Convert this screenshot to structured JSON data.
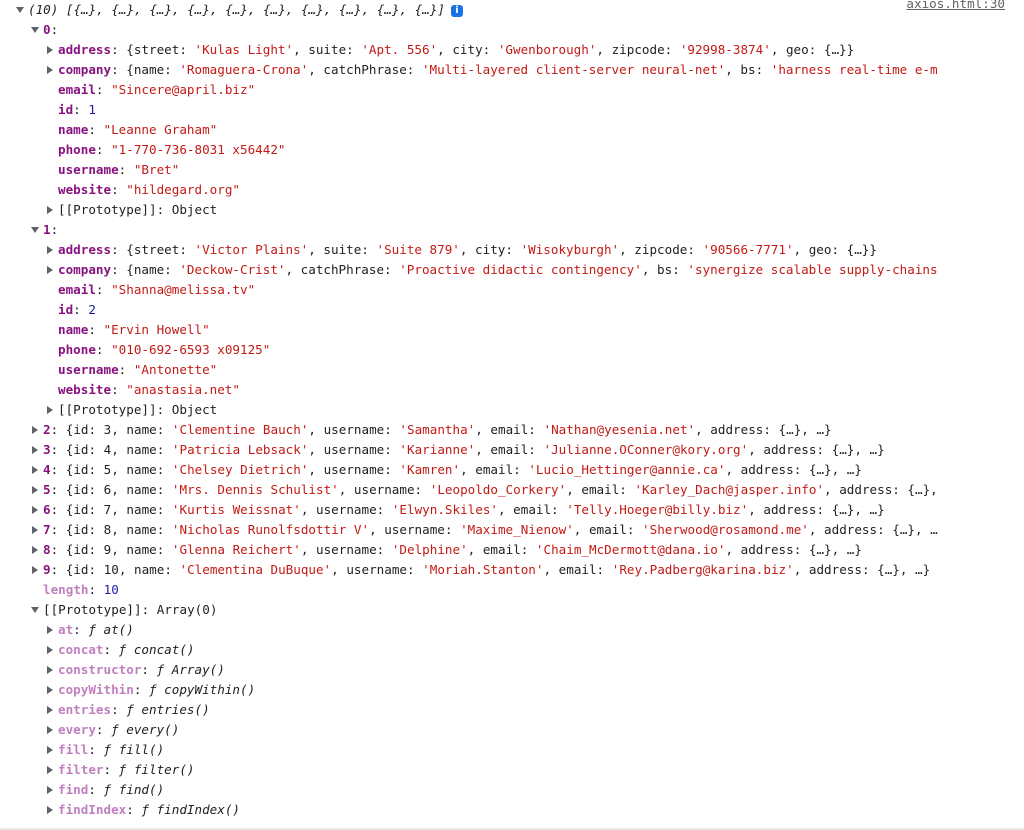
{
  "source_link": "axios.html:30",
  "summary": {
    "label": "(10) [{…}, {…}, {…}, {…}, {…}, {…}, {…}, {…}, {…}, {…}]",
    "info_icon": "info-icon"
  },
  "items": [
    {
      "index": "0",
      "expanded": true,
      "fields": [
        {
          "key": "address",
          "expandable": true,
          "segments": [
            [
              "p",
              "{street: "
            ],
            [
              "s",
              "'Kulas Light'"
            ],
            [
              "p",
              ", suite: "
            ],
            [
              "s",
              "'Apt. 556'"
            ],
            [
              "p",
              ", city: "
            ],
            [
              "s",
              "'Gwenborough'"
            ],
            [
              "p",
              ", zipcode: "
            ],
            [
              "s",
              "'92998-3874'"
            ],
            [
              "p",
              ", geo: {…}}"
            ]
          ]
        },
        {
          "key": "company",
          "expandable": true,
          "segments": [
            [
              "p",
              "{name: "
            ],
            [
              "s",
              "'Romaguera-Crona'"
            ],
            [
              "p",
              ", catchPhrase: "
            ],
            [
              "s",
              "'Multi-layered client-server neural-net'"
            ],
            [
              "p",
              ", bs: "
            ],
            [
              "s",
              "'harness real-time e-m"
            ]
          ]
        },
        {
          "key": "email",
          "expandable": false,
          "segments": [
            [
              "s",
              "\"Sincere@april.biz\""
            ]
          ]
        },
        {
          "key": "id",
          "expandable": false,
          "segments": [
            [
              "n",
              "1"
            ]
          ]
        },
        {
          "key": "name",
          "expandable": false,
          "segments": [
            [
              "s",
              "\"Leanne Graham\""
            ]
          ]
        },
        {
          "key": "phone",
          "expandable": false,
          "segments": [
            [
              "s",
              "\"1-770-736-8031 x56442\""
            ]
          ]
        },
        {
          "key": "username",
          "expandable": false,
          "segments": [
            [
              "s",
              "\"Bret\""
            ]
          ]
        },
        {
          "key": "website",
          "expandable": false,
          "segments": [
            [
              "s",
              "\"hildegard.org\""
            ]
          ]
        },
        {
          "key": "[[Prototype]]",
          "expandable": true,
          "plainkey": true,
          "segments": [
            [
              "p",
              "Object"
            ]
          ]
        }
      ]
    },
    {
      "index": "1",
      "expanded": true,
      "fields": [
        {
          "key": "address",
          "expandable": true,
          "segments": [
            [
              "p",
              "{street: "
            ],
            [
              "s",
              "'Victor Plains'"
            ],
            [
              "p",
              ", suite: "
            ],
            [
              "s",
              "'Suite 879'"
            ],
            [
              "p",
              ", city: "
            ],
            [
              "s",
              "'Wisokyburgh'"
            ],
            [
              "p",
              ", zipcode: "
            ],
            [
              "s",
              "'90566-7771'"
            ],
            [
              "p",
              ", geo: {…}}"
            ]
          ]
        },
        {
          "key": "company",
          "expandable": true,
          "segments": [
            [
              "p",
              "{name: "
            ],
            [
              "s",
              "'Deckow-Crist'"
            ],
            [
              "p",
              ", catchPhrase: "
            ],
            [
              "s",
              "'Proactive didactic contingency'"
            ],
            [
              "p",
              ", bs: "
            ],
            [
              "s",
              "'synergize scalable supply-chains"
            ]
          ]
        },
        {
          "key": "email",
          "expandable": false,
          "segments": [
            [
              "s",
              "\"Shanna@melissa.tv\""
            ]
          ]
        },
        {
          "key": "id",
          "expandable": false,
          "segments": [
            [
              "n",
              "2"
            ]
          ]
        },
        {
          "key": "name",
          "expandable": false,
          "segments": [
            [
              "s",
              "\"Ervin Howell\""
            ]
          ]
        },
        {
          "key": "phone",
          "expandable": false,
          "segments": [
            [
              "s",
              "\"010-692-6593 x09125\""
            ]
          ]
        },
        {
          "key": "username",
          "expandable": false,
          "segments": [
            [
              "s",
              "\"Antonette\""
            ]
          ]
        },
        {
          "key": "website",
          "expandable": false,
          "segments": [
            [
              "s",
              "\"anastasia.net\""
            ]
          ]
        },
        {
          "key": "[[Prototype]]",
          "expandable": true,
          "plainkey": true,
          "segments": [
            [
              "p",
              "Object"
            ]
          ]
        }
      ]
    },
    {
      "index": "2",
      "expanded": false,
      "segments": [
        [
          "p",
          "{id: 3, name: "
        ],
        [
          "s",
          "'Clementine Bauch'"
        ],
        [
          "p",
          ", username: "
        ],
        [
          "s",
          "'Samantha'"
        ],
        [
          "p",
          ", email: "
        ],
        [
          "s",
          "'Nathan@yesenia.net'"
        ],
        [
          "p",
          ", address: {…}, …}"
        ]
      ]
    },
    {
      "index": "3",
      "expanded": false,
      "segments": [
        [
          "p",
          "{id: 4, name: "
        ],
        [
          "s",
          "'Patricia Lebsack'"
        ],
        [
          "p",
          ", username: "
        ],
        [
          "s",
          "'Karianne'"
        ],
        [
          "p",
          ", email: "
        ],
        [
          "s",
          "'Julianne.OConner@kory.org'"
        ],
        [
          "p",
          ", address: {…}, …}"
        ]
      ]
    },
    {
      "index": "4",
      "expanded": false,
      "segments": [
        [
          "p",
          "{id: 5, name: "
        ],
        [
          "s",
          "'Chelsey Dietrich'"
        ],
        [
          "p",
          ", username: "
        ],
        [
          "s",
          "'Kamren'"
        ],
        [
          "p",
          ", email: "
        ],
        [
          "s",
          "'Lucio_Hettinger@annie.ca'"
        ],
        [
          "p",
          ", address: {…}, …}"
        ]
      ]
    },
    {
      "index": "5",
      "expanded": false,
      "segments": [
        [
          "p",
          "{id: 6, name: "
        ],
        [
          "s",
          "'Mrs. Dennis Schulist'"
        ],
        [
          "p",
          ", username: "
        ],
        [
          "s",
          "'Leopoldo_Corkery'"
        ],
        [
          "p",
          ", email: "
        ],
        [
          "s",
          "'Karley_Dach@jasper.info'"
        ],
        [
          "p",
          ", address: {…},"
        ]
      ]
    },
    {
      "index": "6",
      "expanded": false,
      "segments": [
        [
          "p",
          "{id: 7, name: "
        ],
        [
          "s",
          "'Kurtis Weissnat'"
        ],
        [
          "p",
          ", username: "
        ],
        [
          "s",
          "'Elwyn.Skiles'"
        ],
        [
          "p",
          ", email: "
        ],
        [
          "s",
          "'Telly.Hoeger@billy.biz'"
        ],
        [
          "p",
          ", address: {…}, …}"
        ]
      ]
    },
    {
      "index": "7",
      "expanded": false,
      "segments": [
        [
          "p",
          "{id: 8, name: "
        ],
        [
          "s",
          "'Nicholas Runolfsdottir V'"
        ],
        [
          "p",
          ", username: "
        ],
        [
          "s",
          "'Maxime_Nienow'"
        ],
        [
          "p",
          ", email: "
        ],
        [
          "s",
          "'Sherwood@rosamond.me'"
        ],
        [
          "p",
          ", address: {…}, …"
        ]
      ]
    },
    {
      "index": "8",
      "expanded": false,
      "segments": [
        [
          "p",
          "{id: 9, name: "
        ],
        [
          "s",
          "'Glenna Reichert'"
        ],
        [
          "p",
          ", username: "
        ],
        [
          "s",
          "'Delphine'"
        ],
        [
          "p",
          ", email: "
        ],
        [
          "s",
          "'Chaim_McDermott@dana.io'"
        ],
        [
          "p",
          ", address: {…}, …}"
        ]
      ]
    },
    {
      "index": "9",
      "expanded": false,
      "segments": [
        [
          "p",
          "{id: 10, name: "
        ],
        [
          "s",
          "'Clementina DuBuque'"
        ],
        [
          "p",
          ", username: "
        ],
        [
          "s",
          "'Moriah.Stanton'"
        ],
        [
          "p",
          ", email: "
        ],
        [
          "s",
          "'Rey.Padberg@karina.biz'"
        ],
        [
          "p",
          ", address: {…}, …}"
        ]
      ]
    }
  ],
  "length": {
    "key": "length",
    "value": "10"
  },
  "array_prototype": {
    "key": "[[Prototype]]",
    "value": "Array(0)",
    "methods": [
      {
        "key": "at",
        "value": "at()"
      },
      {
        "key": "concat",
        "value": "concat()"
      },
      {
        "key": "constructor",
        "value": "Array()"
      },
      {
        "key": "copyWithin",
        "value": "copyWithin()"
      },
      {
        "key": "entries",
        "value": "entries()"
      },
      {
        "key": "every",
        "value": "every()"
      },
      {
        "key": "fill",
        "value": "fill()"
      },
      {
        "key": "filter",
        "value": "filter()"
      },
      {
        "key": "find",
        "value": "find()"
      },
      {
        "key": "findIndex",
        "value": "findIndex()"
      }
    ]
  }
}
